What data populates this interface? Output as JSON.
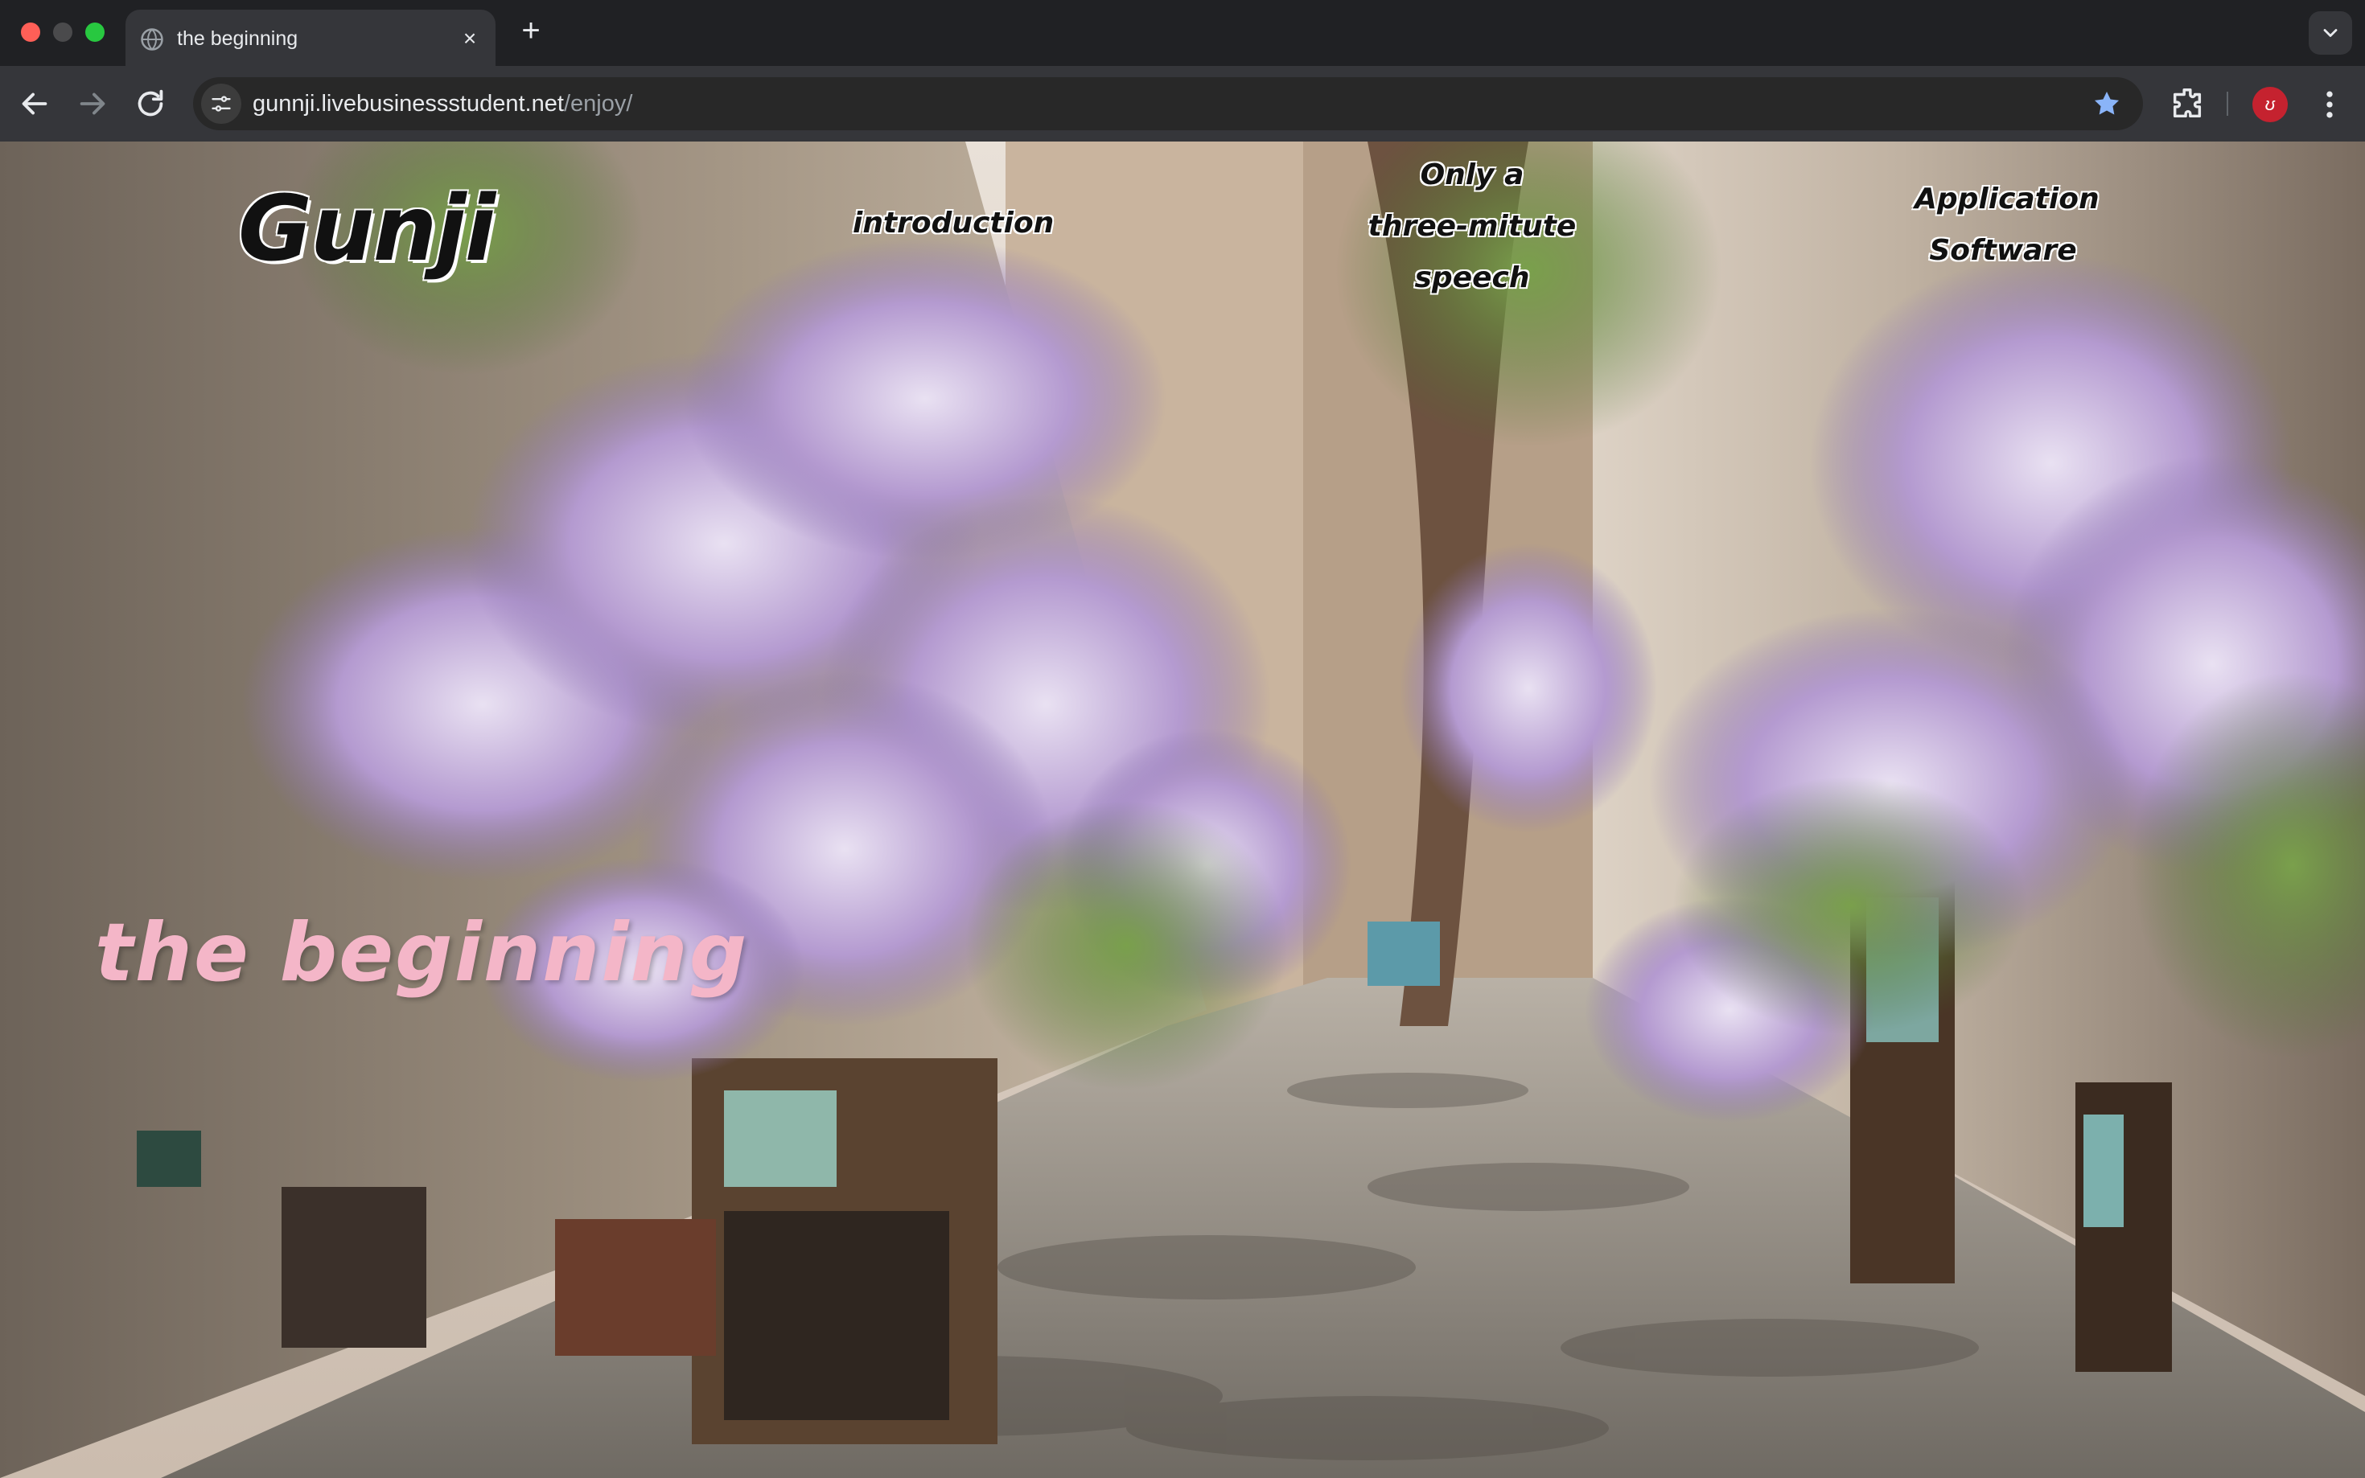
{
  "browser": {
    "tab": {
      "title": "the beginning",
      "favicon": "globe-icon",
      "close": "×"
    },
    "new_tab": "+",
    "url": {
      "host": "gunnji.livebusinessstudent.net",
      "path": "/enjoy/"
    },
    "profile_initial": "ʊ",
    "colors": {
      "tab_bg": "#35363a",
      "chrome_bg": "#202124",
      "star": "#8ab4f8",
      "profile": "#c5222f"
    }
  },
  "page": {
    "logo": "Gunji",
    "nav": {
      "introduction": "introduction",
      "speech": "Only a three-mitute speech",
      "application": "Application Software"
    },
    "hero_title": "the beginning",
    "background": "alley-with-wisteria-illustration",
    "colors": {
      "hero_text": "#f4b6c8",
      "nav_text": "#111111"
    }
  }
}
